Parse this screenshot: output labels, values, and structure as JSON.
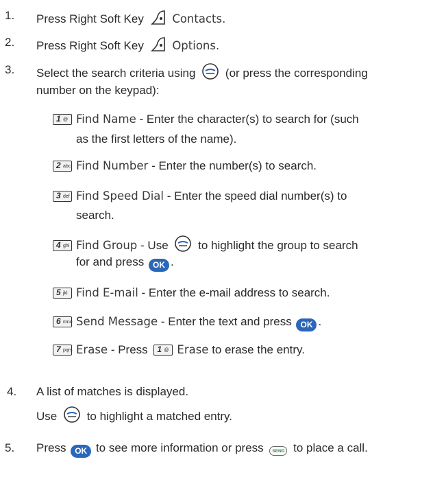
{
  "icons": {
    "ok": "OK",
    "send": "SEND"
  },
  "steps": [
    {
      "num": "1.",
      "text": "Press Right Soft Key",
      "ui": "Contacts."
    },
    {
      "num": "2.",
      "text": "Press Right Soft Key",
      "ui": "Options."
    },
    {
      "num": "3.",
      "text_a": "Select the search criteria using",
      "text_b": "(or press the corresponding",
      "text_c": "number on the keypad):"
    },
    {
      "num": "4.",
      "text": "A list of matches is displayed.",
      "text_b": "Use",
      "text_c": "to highlight a matched entry."
    },
    {
      "num": "5.",
      "text_a": "Press",
      "text_b": "to see more information or press",
      "text_c": "to place a call."
    }
  ],
  "options": [
    {
      "label": "Find Name",
      "desc": "- Enter the character(s) to search for (such",
      "desc2": "as the first letters of the name)."
    },
    {
      "label": "Find Number",
      "desc": "- Enter the number(s) to search."
    },
    {
      "label": "Find Speed Dial",
      "desc": "- Enter the speed dial number(s) to",
      "desc2": "search."
    },
    {
      "label": "Find Group",
      "desc": "- Use",
      "desc_b": "to highlight the group to search",
      "desc2": "for and press",
      "desc2_end": "."
    },
    {
      "label": "Find E-mail",
      "desc": "- Enter the e-mail address to search."
    },
    {
      "label": "Send Message",
      "desc": "- Enter the text and press",
      "desc_end": "."
    },
    {
      "label": "Erase",
      "desc": "- Press",
      "inline_label": "Erase",
      "desc_b": "to erase the entry."
    }
  ]
}
